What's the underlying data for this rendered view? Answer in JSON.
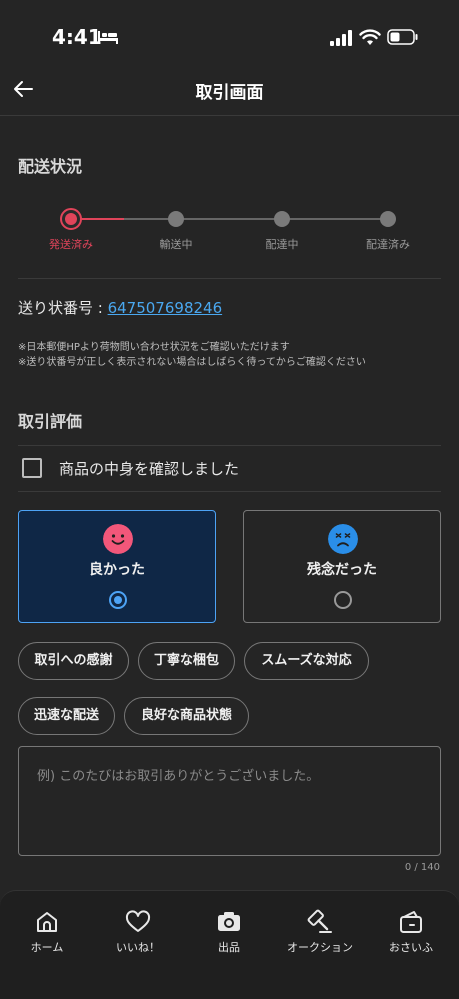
{
  "status_bar": {
    "time": "4:41"
  },
  "header": {
    "title": "取引画面"
  },
  "delivery": {
    "title": "配送状況",
    "steps": [
      "発送済み",
      "輸送中",
      "配達中",
      "配達済み"
    ],
    "current_step": 1,
    "tracking_label": "送り状番号 : ",
    "tracking_number": "647507698246",
    "notes": [
      "※日本郵便HPより荷物問い合わせ状況をご確認いただけます",
      "※送り状番号が正しく表示されない場合はしばらく待ってからご確認ください"
    ]
  },
  "rating": {
    "title": "取引評価",
    "checkbox_label": "商品の中身を確認しました",
    "good_label": "良かった",
    "bad_label": "残念だった",
    "selected": "good",
    "chips": [
      "取引への感謝",
      "丁寧な梱包",
      "スムーズな対応",
      "迅速な配送",
      "良好な商品状態"
    ],
    "comment_placeholder": "例) このたびはお取引ありがとうございました。",
    "counter": "0 / 140"
  },
  "tabs": [
    "ホーム",
    "いいね！",
    "出品",
    "オークション",
    "おさいふ"
  ],
  "colors": {
    "accent_red": "#e0445a",
    "accent_blue": "#4da3f5",
    "good_face": "#f2577a",
    "bad_face": "#2a8ee8",
    "background": "#252525"
  }
}
